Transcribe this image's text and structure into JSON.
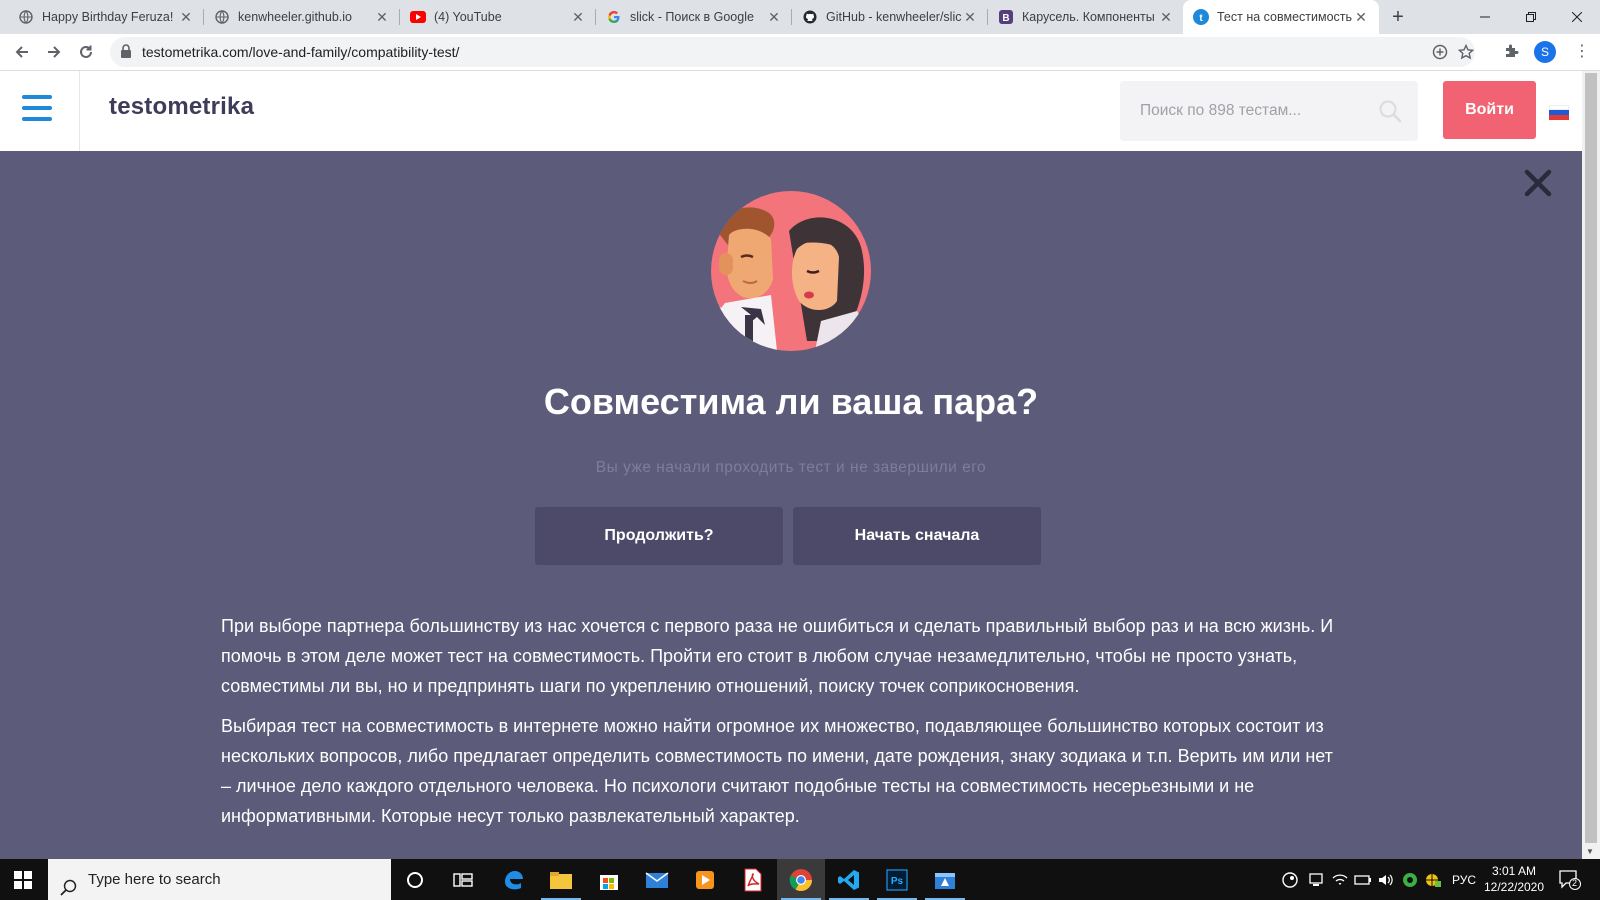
{
  "browser": {
    "tabs": [
      {
        "title": "Happy Birthday Feruza!",
        "icon": "globe-icon"
      },
      {
        "title": "kenwheeler.github.io",
        "icon": "globe-icon"
      },
      {
        "title": "(4) YouTube",
        "icon": "youtube-icon"
      },
      {
        "title": "slick - Поиск в Google",
        "icon": "google-icon"
      },
      {
        "title": "GitHub - kenwheeler/slic",
        "icon": "github-icon"
      },
      {
        "title": "Карусель. Компоненты",
        "icon": "bootstrap-icon"
      },
      {
        "title": "Тест на совместимость",
        "icon": "testometrika-icon"
      }
    ],
    "new_tab": "+",
    "url": "testometrika.com/love-and-family/compatibility-test/",
    "profile_initial": "S"
  },
  "site": {
    "logo": "testometrika",
    "search_placeholder": "Поиск по 898 тестам...",
    "login_label": "Войти"
  },
  "main": {
    "headline": "Совместима ли ваша пара?",
    "subtitle": "Вы уже начали проходить тест и не завершили его",
    "continue_label": "Продолжить?",
    "restart_label": "Начать сначала",
    "paragraphs": [
      [
        "При выборе партнера большинству из нас хочется с первого раза не ошибиться и сделать правильный выбор раз и на всю жизнь. И",
        "помочь в этом деле может тест на совместимость. Пройти его стоит в любом случае незамедлительно, чтобы не просто узнать,",
        "совместимы ли вы, но и предпринять шаги по укреплению отношений, поиску точек соприкосновения."
      ],
      [
        "Выбирая тест на совместимость в интернете можно найти огромное их множество, подавляющее большинство которых состоит из",
        "нескольких вопросов, либо предлагает определить совместимость по имени, дате рождения, знаку зодиака и т.п. Верить им или нет",
        "– личное дело каждого отдельного человека. Но психологи считают подобные тесты на совместимость несерьезными и не",
        "информативными. Которые несут только развлекательный характер."
      ]
    ]
  },
  "taskbar": {
    "search_placeholder": "Type here to search",
    "language": "РУС",
    "time": "3:01 AM",
    "date": "12/22/2020",
    "notification_count": "2"
  },
  "colors": {
    "page_bg": "#5d5b7a",
    "button_bg": "#4c4a68",
    "login_bg": "#f16373",
    "hamburger": "#1e88d9",
    "logo": "#3e3c58"
  }
}
